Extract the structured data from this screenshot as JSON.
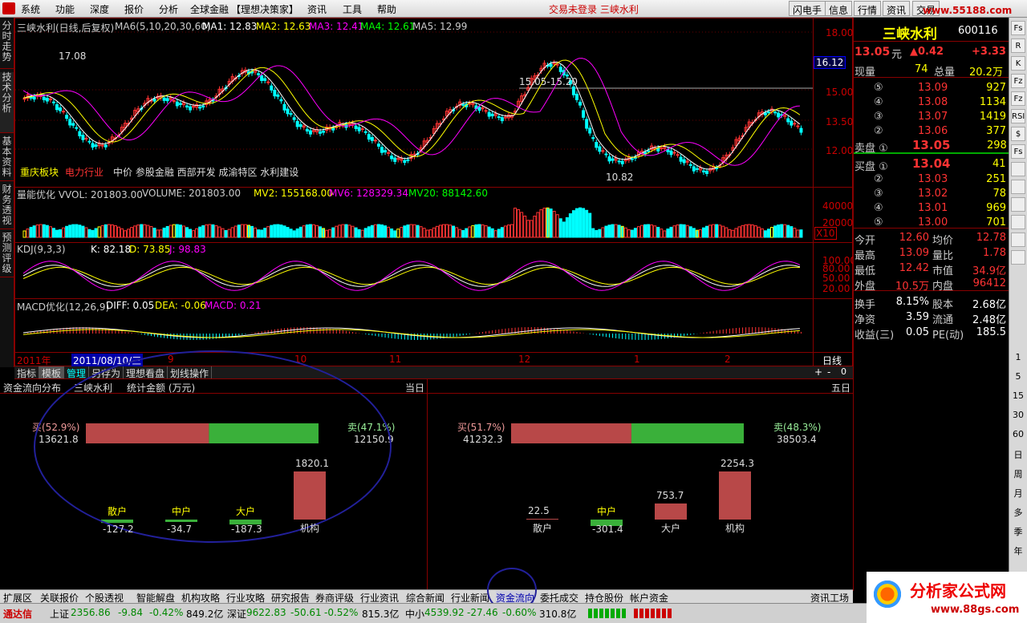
{
  "menu": {
    "items": [
      "系统",
      "功能",
      "深度",
      "报价",
      "分析",
      "全球金融",
      "【理想决策家】",
      "资讯",
      "工具",
      "帮助"
    ],
    "alert": "交易未登录  三峡水利",
    "right_buttons": [
      "闪电手",
      "信息",
      "行情",
      "资讯",
      "交易"
    ],
    "watermark": "www.55188.com"
  },
  "left_tabs": [
    "分时走势",
    "技术分析",
    "基本资料",
    "财务透视",
    "预测评级"
  ],
  "chart": {
    "title": "三峡水利(日线,后复权)",
    "ma_label": "MA6(5,10,20,30,60)",
    "ma": [
      {
        "label": "MA1: 12.83",
        "color": "#ffffff"
      },
      {
        "label": "MA2: 12.63",
        "color": "#ffff00"
      },
      {
        "label": "MA3: 12.41",
        "color": "#ff00ff"
      },
      {
        "label": "MA4: 12.61",
        "color": "#00ff00"
      },
      {
        "label": "MA5: 12.99",
        "color": "#cccccc"
      }
    ],
    "price_axis": [
      "18.00",
      "16.12",
      "15.00",
      "13.50",
      "12.00"
    ],
    "current_price_tag": "16.12",
    "high_annotation": "17.08",
    "range_annotation": "15.05-15.20",
    "low_annotation": "10.82",
    "sector_tags": [
      "重庆板块",
      "电力行业",
      "中价 参股金融 西部开发 成渝特区 水利建设"
    ],
    "volume": {
      "title": "量能优化 VVOL: 201803.00",
      "volume_label": "VOLUME: 201803.00",
      "mv2": "MV2: 155168.00",
      "mv6": "MV6: 128329.34",
      "mv20": "MV20: 88142.60",
      "axis": [
        "40000",
        "20000"
      ],
      "unit": "X10"
    },
    "kdj": {
      "title": "KDJ(9,3,3)",
      "k": "K: 82.18",
      "d": "D: 73.85",
      "j": "J: 98.83",
      "axis": [
        "100.00",
        "80.00",
        "50.00",
        "20.00"
      ]
    },
    "macd": {
      "title": "MACD优化(12,26,9)",
      "diff": "DIFF: 0.05",
      "dea": "DEA: -0.06",
      "macd": "MACD: 0.21"
    },
    "time_axis": {
      "year": "2011年",
      "cursor_date": "2011/08/10/三",
      "months": [
        "9",
        "10",
        "11",
        "12",
        "1",
        "2"
      ],
      "period": "日线"
    }
  },
  "toolbar": [
    "指标",
    "模板",
    "管理",
    "另存为",
    "理想看盘",
    "划线操作"
  ],
  "quote": {
    "name": "三峡水利",
    "code": "600116",
    "price": "13.05",
    "price_unit": "元",
    "change": "▲0.42",
    "change_pct": "+3.33",
    "now_vol_label": "现量",
    "now_vol": "74",
    "total_label": "总量",
    "total": "20.2万",
    "sells": [
      {
        "label": "⑤",
        "price": "13.09",
        "vol": "927"
      },
      {
        "label": "④",
        "price": "13.08",
        "vol": "1134"
      },
      {
        "label": "③",
        "price": "13.07",
        "vol": "1419"
      },
      {
        "label": "②",
        "price": "13.06",
        "vol": "377"
      }
    ],
    "sell1": {
      "label": "卖盘 ①",
      "price": "13.05",
      "vol": "298"
    },
    "buy1": {
      "label": "买盘 ①",
      "price": "13.04",
      "vol": "41"
    },
    "buys": [
      {
        "label": "②",
        "price": "13.03",
        "vol": "251"
      },
      {
        "label": "③",
        "price": "13.02",
        "vol": "78"
      },
      {
        "label": "④",
        "price": "13.01",
        "vol": "969"
      },
      {
        "label": "⑤",
        "price": "13.00",
        "vol": "701"
      }
    ],
    "stats": [
      {
        "l1": "今开",
        "v1": "12.60",
        "l2": "均价",
        "v2": "12.78"
      },
      {
        "l1": "最高",
        "v1": "13.09",
        "l2": "量比",
        "v2": "1.78"
      },
      {
        "l1": "最低",
        "v1": "12.42",
        "l2": "市值",
        "v2": "34.9亿"
      },
      {
        "l1": "外盘",
        "v1": "10.5万",
        "l2": "内盘",
        "v2": "96412"
      },
      {
        "l1": "换手",
        "v1": "8.15%",
        "l2": "股本",
        "v2": "2.68亿"
      },
      {
        "l1": "净资",
        "v1": "3.59",
        "l2": "流通",
        "v2": "2.48亿"
      },
      {
        "l1": "收益(三)",
        "v1": "0.05",
        "l2": "PE(动)",
        "v2": "185.5"
      }
    ]
  },
  "right_icons": [
    "Fs",
    "R",
    "K",
    "Fz",
    "Fz",
    "RSI",
    "$",
    "Fs"
  ],
  "right_numbers": [
    "1",
    "5",
    "15",
    "30",
    "60",
    "日",
    "周",
    "月",
    "多",
    "季",
    "年"
  ],
  "fund": {
    "title": "资金流向分布",
    "stock": "三峡水利",
    "unit": "统计金额 (万元)",
    "period_today": "当日",
    "period_5day": "五日",
    "today": {
      "buy_label": "买(52.9%)",
      "buy_val": "13621.8",
      "sell_label": "卖(47.1%)",
      "sell_val": "12150.9",
      "buy_frac": 0.529,
      "cats": [
        {
          "name": "散户",
          "val": "-127.2",
          "v": -127.2
        },
        {
          "name": "中户",
          "val": "-34.7",
          "v": -34.7
        },
        {
          "name": "大户",
          "val": "-187.3",
          "v": -187.3
        },
        {
          "name": "机构",
          "val": "1820.1",
          "v": 1820.1
        }
      ]
    },
    "five": {
      "buy_label": "买(51.7%)",
      "buy_val": "41232.3",
      "sell_label": "卖(48.3%)",
      "sell_val": "38503.4",
      "buy_frac": 0.517,
      "cats": [
        {
          "name": "散户",
          "val": "22.5",
          "v": 22.5
        },
        {
          "name": "中户",
          "val": "-301.4",
          "v": -301.4
        },
        {
          "name": "大户",
          "val": "753.7",
          "v": 753.7
        },
        {
          "name": "机构",
          "val": "2254.3",
          "v": 2254.3
        }
      ]
    }
  },
  "bottom_tabs": [
    "扩展区",
    "关联报价",
    "个股透视",
    "智能解盘",
    "机构攻略",
    "行业攻略",
    "研究报告",
    "券商评级",
    "行业资讯",
    "综合新闻",
    "行业新闻",
    "资金流向",
    "委托成交",
    "持仓股份",
    "帐户资金"
  ],
  "bottom_right": "资讯工场",
  "status": {
    "app": "通达信",
    "idx1_name": "上证",
    "idx1": "2356.86",
    "idx1_chg": "-9.84",
    "idx1_pct": "-0.42%",
    "idx1_amt": "849.2亿",
    "idx2_name": "深证",
    "idx2": "9622.83",
    "idx2_chg": "-50.61",
    "idx2_pct": "-0.52%",
    "idx2_amt": "815.3亿",
    "idx3_name": "中小",
    "idx3": "4539.92",
    "idx3_chg": "-27.46",
    "idx3_pct": "-0.60%",
    "idx3_amt": "310.8亿"
  },
  "brand": {
    "name": "分析家公式网",
    "url": "www.88gs.com"
  },
  "colors": {
    "up": "#ff3333",
    "down": "#00ffff",
    "accent": "#ffff00",
    "frame": "#880000"
  }
}
